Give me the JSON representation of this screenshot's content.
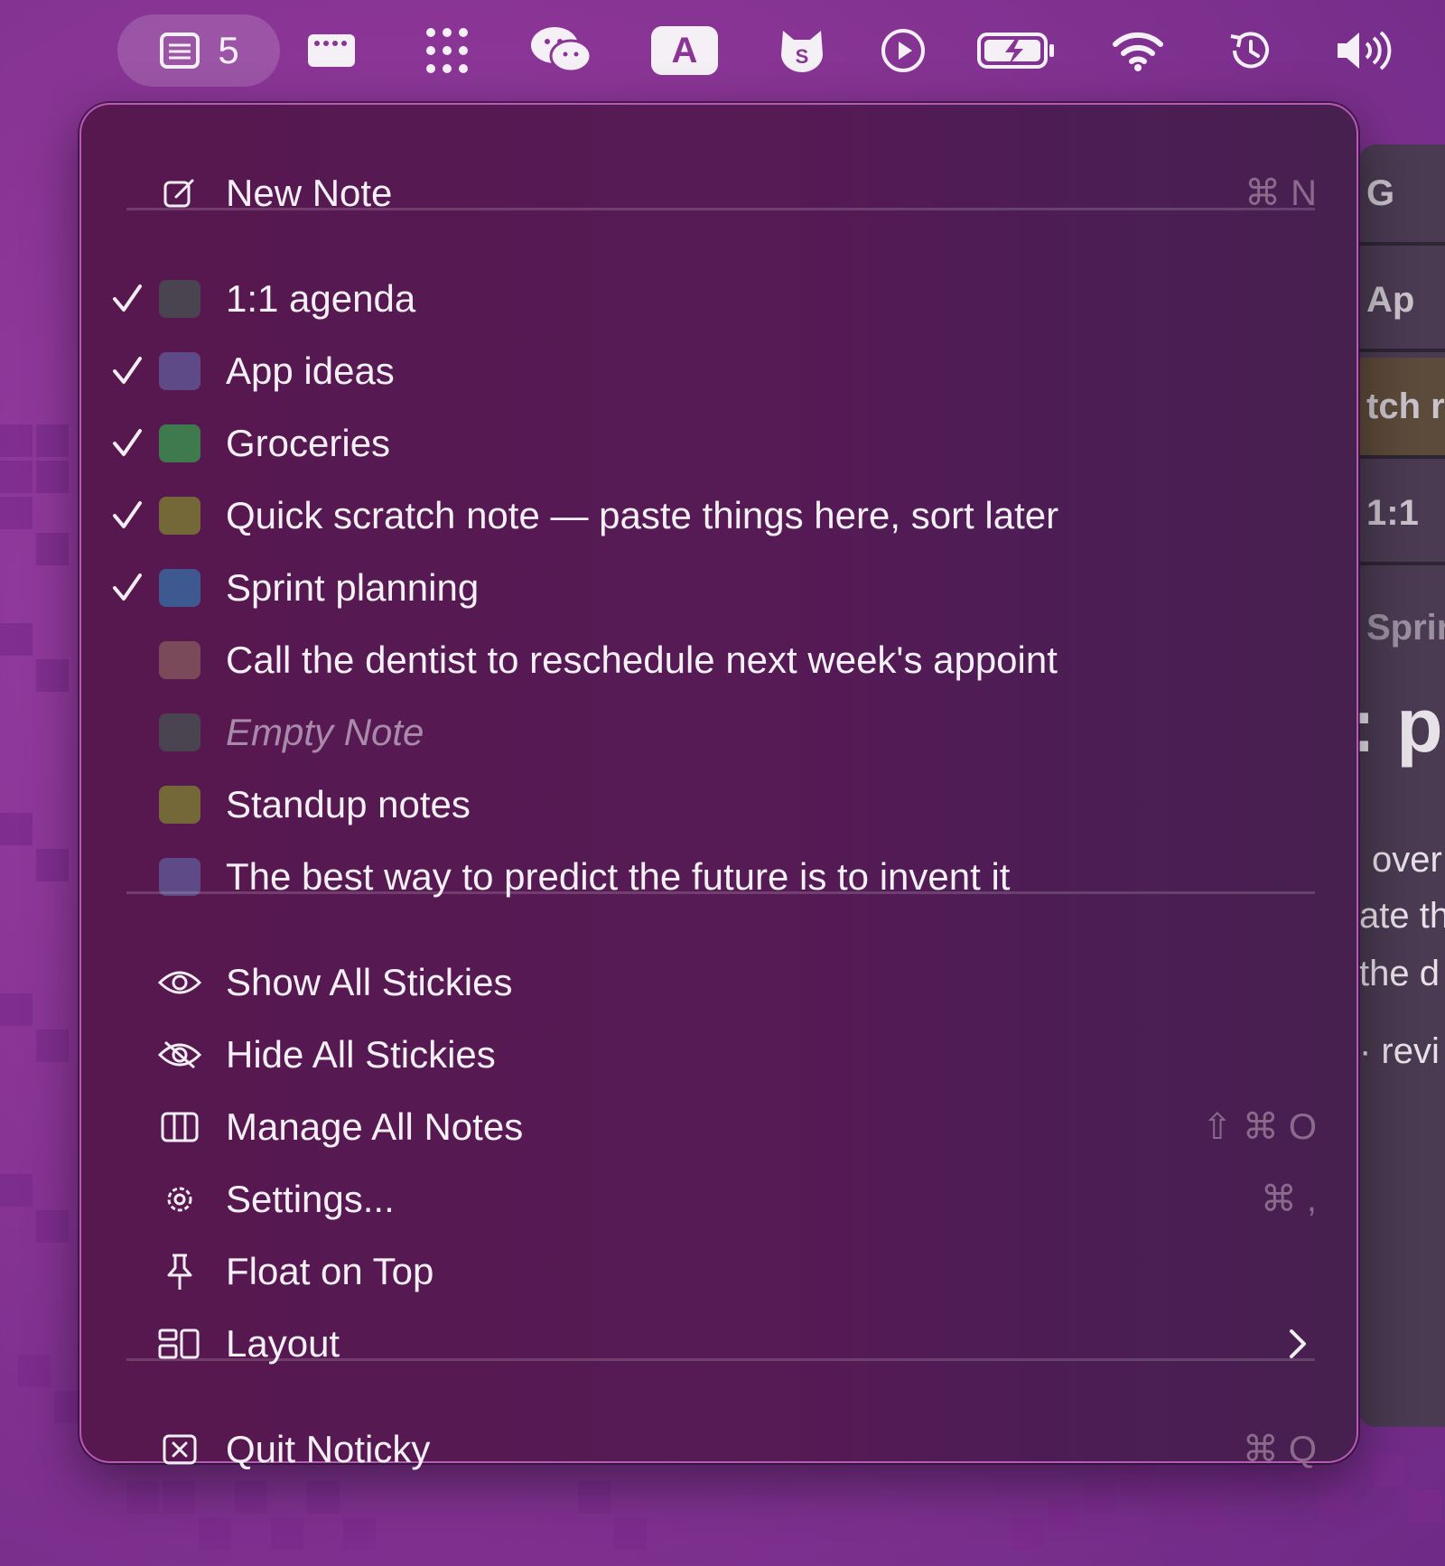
{
  "menubar": {
    "notes_count": "5",
    "input_badge": "A",
    "icons": [
      "notes-icon",
      "keyboard-icon",
      "grid-dots-icon",
      "wechat-icon",
      "input-source-icon",
      "cat-s-icon",
      "play-circle-icon",
      "battery-charging-icon",
      "wifi-icon",
      "time-machine-icon",
      "volume-icon"
    ]
  },
  "menu": {
    "new_note": {
      "label": "New Note",
      "shortcut": "⌘ N"
    },
    "notes": [
      {
        "label": "1:1 agenda",
        "checked": true,
        "color": "#4a4450"
      },
      {
        "label": "App ideas",
        "checked": true,
        "color": "#5e4a86"
      },
      {
        "label": "Groceries",
        "checked": true,
        "color": "#3f7a4e"
      },
      {
        "label": "Quick scratch note — paste things here, sort later",
        "checked": true,
        "color": "#746838"
      },
      {
        "label": "Sprint planning",
        "checked": true,
        "color": "#3e5990"
      },
      {
        "label": "Call the dentist to reschedule next week's appoint",
        "checked": false,
        "color": "#7b4a5a"
      },
      {
        "label": "Empty Note",
        "checked": false,
        "color": "#4a4450",
        "italic": true
      },
      {
        "label": "Standup notes",
        "checked": false,
        "color": "#746838"
      },
      {
        "label": "The best way to predict the future is to invent it",
        "checked": false,
        "color": "#5e4a86"
      }
    ],
    "show_all": {
      "label": "Show All Stickies"
    },
    "hide_all": {
      "label": "Hide All Stickies"
    },
    "manage_all": {
      "label": "Manage All Notes",
      "shortcut": "⇧ ⌘ O"
    },
    "settings": {
      "label": "Settings...",
      "shortcut": "⌘ ,"
    },
    "float_on_top": {
      "label": "Float on Top"
    },
    "layout": {
      "label": "Layout"
    },
    "quit": {
      "label": "Quit Noticky",
      "shortcut": "⌘ Q"
    }
  },
  "background_window": {
    "rows": [
      "G",
      "Ap",
      "tch r",
      "1:1"
    ],
    "texts": [
      "Sprir",
      ": p",
      "over",
      "ate th",
      "the d",
      "· revi"
    ]
  },
  "colors": {
    "accent": "#b65ab8",
    "desktop": "#8a3596"
  }
}
